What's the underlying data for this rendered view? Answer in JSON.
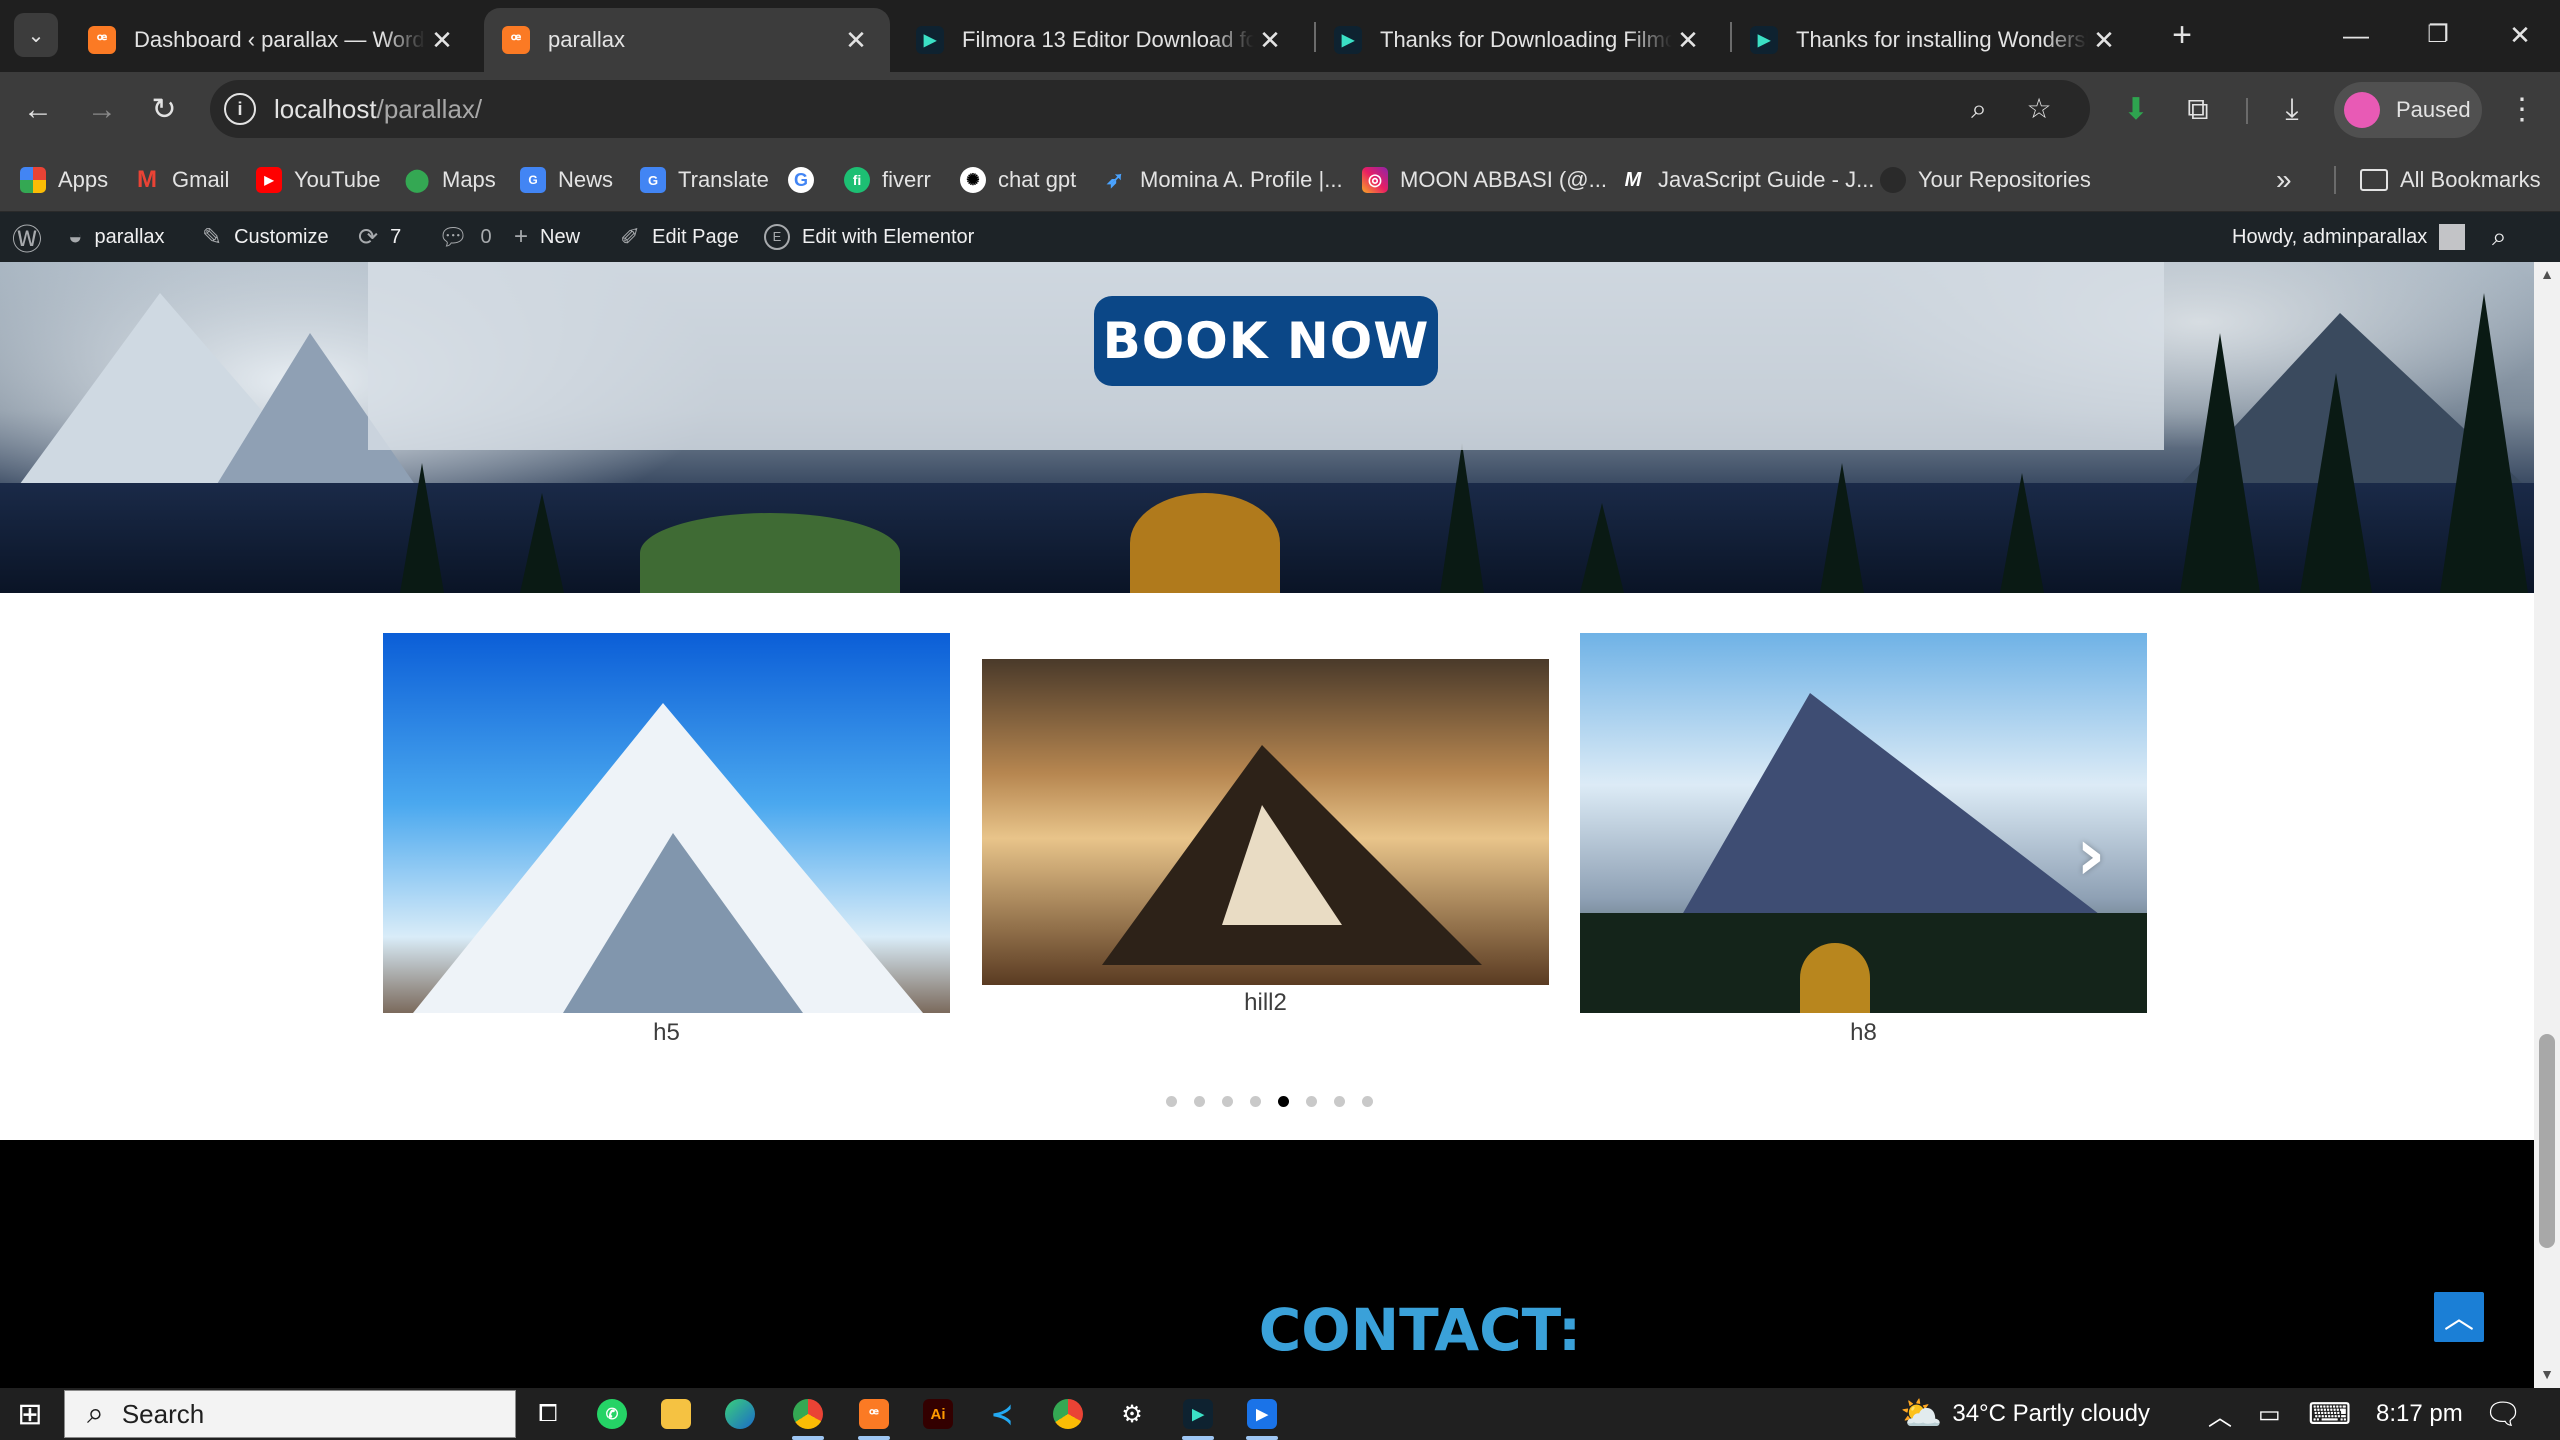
{
  "browser": {
    "tabs": [
      {
        "title": "Dashboard ‹ parallax — WordPress",
        "icon": "xampp-icon",
        "active": false
      },
      {
        "title": "parallax",
        "icon": "xampp-icon",
        "active": true
      },
      {
        "title": "Filmora 13 Editor Download for",
        "icon": "filmora-icon",
        "active": false
      },
      {
        "title": "Thanks for Downloading Filmora",
        "icon": "filmora-icon",
        "active": false
      },
      {
        "title": "Thanks for installing Wondershare",
        "icon": "filmora-icon",
        "active": false
      }
    ],
    "url_host": "localhost",
    "url_path": "/parallax/",
    "profile_status": "Paused"
  },
  "bookmarks": {
    "items": [
      "Apps",
      "Gmail",
      "YouTube",
      "Maps",
      "News",
      "Translate",
      "",
      "fiverr",
      "chat gpt",
      "Momina A. Profile |...",
      "MOON ABBASI (@...",
      "JavaScript Guide - J...",
      "Your Repositories"
    ],
    "all_label": "All Bookmarks"
  },
  "wp_admin_bar": {
    "site": "parallax",
    "customize": "Customize",
    "updates": "7",
    "comments": "0",
    "new": "New",
    "edit_page": "Edit Page",
    "elementor": "Edit with Elementor",
    "howdy": "Howdy, adminparallax"
  },
  "hero": {
    "cta": "BOOK NOW"
  },
  "carousel": {
    "slides": [
      {
        "caption": "h5"
      },
      {
        "caption": "hill2"
      },
      {
        "caption": "h8"
      }
    ],
    "dots": 8,
    "active_dot": 4
  },
  "contact": {
    "title": "CONTACT:"
  },
  "taskbar": {
    "search_placeholder": "Search",
    "weather": "34°C  Partly cloudy",
    "time": "8:17 pm"
  },
  "colors": {
    "book_button": "#0b4787",
    "contact_title": "#3aa1d9",
    "scroll_top": "#1b7fd6"
  }
}
